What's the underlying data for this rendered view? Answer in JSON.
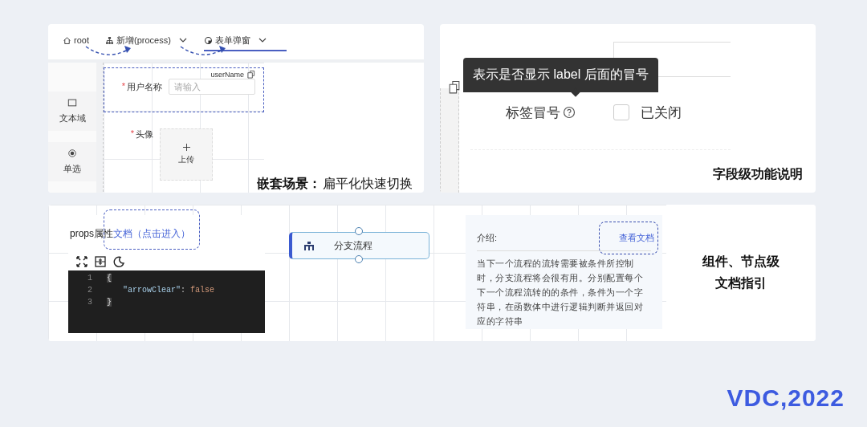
{
  "nested_panel": {
    "breadcrumbs": [
      {
        "label": "root",
        "selected": false
      },
      {
        "label": "新增(process)",
        "selected": false,
        "dropdown": true
      },
      {
        "label": "表单弹窗",
        "selected": true,
        "dropdown": true
      }
    ],
    "palette": [
      {
        "label": "文本域"
      },
      {
        "label": "单选"
      }
    ],
    "field_key": "userName",
    "fields": [
      {
        "label": "用户名称",
        "required": true,
        "required_mark": "*",
        "kind": "input",
        "placeholder": "请输入"
      },
      {
        "label": "头像",
        "required": true,
        "required_mark": "*",
        "kind": "upload",
        "button": "上传"
      }
    ],
    "caption_title": "嵌套场景：",
    "caption_subtitle": "扁平化快速切换"
  },
  "field_panel": {
    "rows": [
      {
        "kind": "input"
      },
      {
        "kind": "switch",
        "label": "标签冒号",
        "help": true,
        "checked": false,
        "status": "已关闭"
      }
    ],
    "tooltip": "表示是否显示 label 后面的冒号",
    "caption": "字段级功能说明"
  },
  "doc_panel": {
    "props_title": "props属性",
    "props_link": "文档（点击进入）",
    "code": [
      {
        "number": "1",
        "tokens": [
          {
            "kind": "bracket",
            "text": "{"
          }
        ]
      },
      {
        "number": "2",
        "tokens": [
          {
            "kind": "string",
            "text": "\"arrowClear\""
          },
          {
            "kind": "punct",
            "text": ": "
          },
          {
            "kind": "keyword",
            "text": "false"
          }
        ]
      },
      {
        "number": "3",
        "tokens": [
          {
            "kind": "bracket",
            "text": "}"
          }
        ]
      }
    ],
    "node": {
      "label": "分支流程"
    },
    "intro": {
      "label": "介绍:",
      "link": "查看文档",
      "description": "当下一个流程的流转需要被条件所控制时，分支流程将会很有用。分别配置每个下一个流程流转的的条件，条件为一个字符串，在函数体中进行逻辑判断并返回对应的字符串"
    },
    "caption": [
      "组件、节点级",
      "文档指引"
    ]
  },
  "logo": "VDC,2022"
}
